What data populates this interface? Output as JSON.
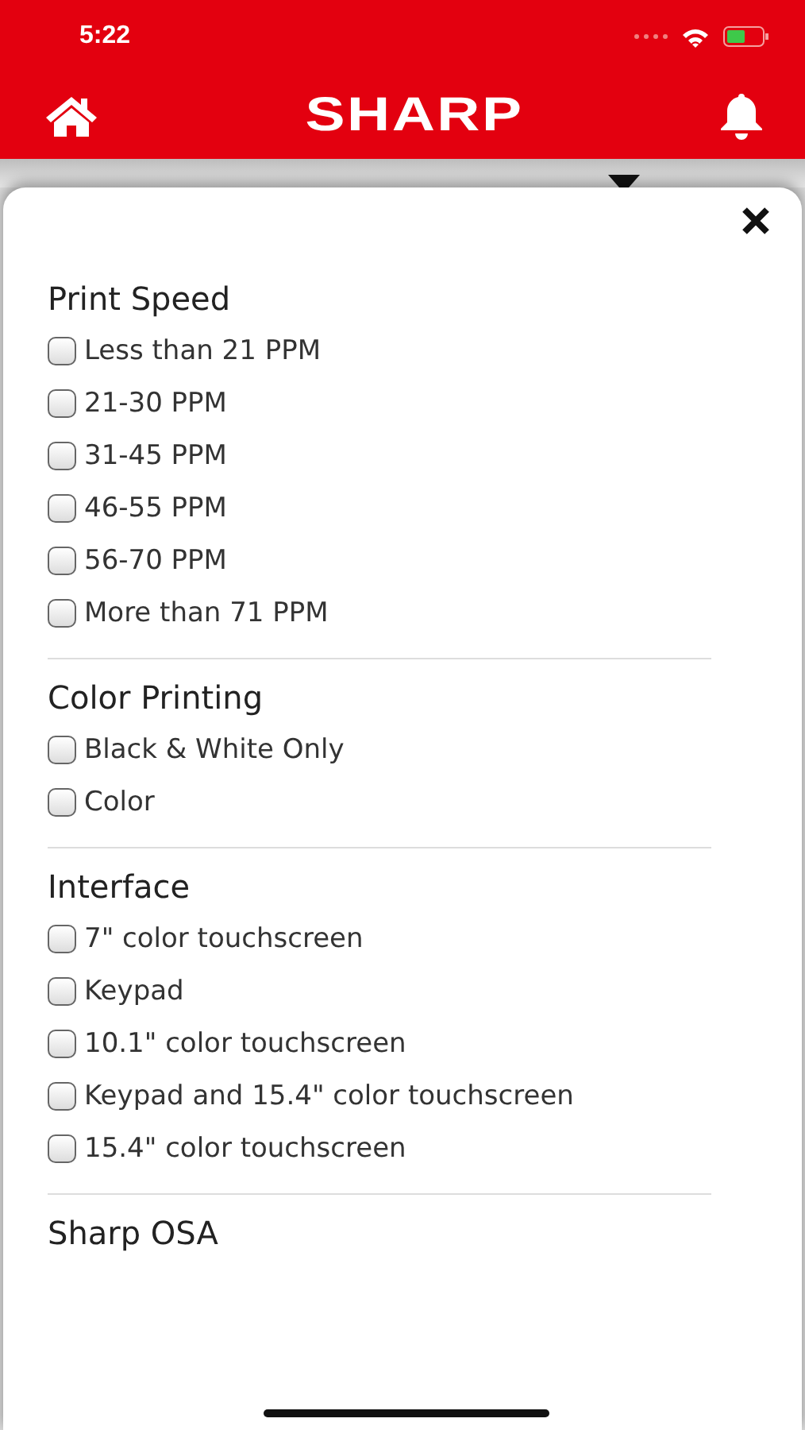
{
  "status_bar": {
    "time": "5:22"
  },
  "header": {
    "logo": "SHARP"
  },
  "filter_sheet": {
    "sections": [
      {
        "title": "Print Speed",
        "options": [
          {
            "label": "Less than 21 PPM",
            "checked": false
          },
          {
            "label": "21-30 PPM",
            "checked": false
          },
          {
            "label": "31-45 PPM",
            "checked": false
          },
          {
            "label": "46-55 PPM",
            "checked": false
          },
          {
            "label": "56-70 PPM",
            "checked": false
          },
          {
            "label": "More than 71 PPM",
            "checked": false
          }
        ]
      },
      {
        "title": "Color Printing",
        "options": [
          {
            "label": "Black & White Only",
            "checked": false
          },
          {
            "label": "Color",
            "checked": false
          }
        ]
      },
      {
        "title": "Interface",
        "options": [
          {
            "label": "7\" color touchscreen",
            "checked": false
          },
          {
            "label": "Keypad",
            "checked": false
          },
          {
            "label": "10.1\" color touchscreen",
            "checked": false
          },
          {
            "label": "Keypad and 15.4\" color touchscreen",
            "checked": false
          },
          {
            "label": "15.4\" color touchscreen",
            "checked": false
          }
        ]
      },
      {
        "title": "Sharp OSA"
      }
    ]
  }
}
